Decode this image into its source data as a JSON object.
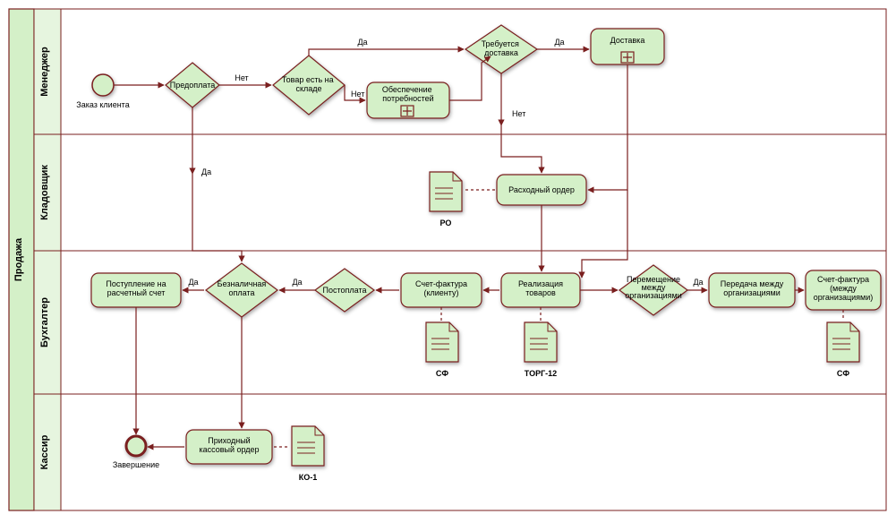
{
  "pool": {
    "title": "Продажа"
  },
  "lanes": [
    {
      "title": "Менеджер"
    },
    {
      "title": "Кладовщик"
    },
    {
      "title": "Бухгалтер"
    },
    {
      "title": "Кассир"
    }
  ],
  "events": {
    "start": {
      "label": "Заказ клиента"
    },
    "end": {
      "label": "Завершение"
    }
  },
  "gateways": {
    "prepay": "Предоплата",
    "stock": "Товар есть на складе",
    "delivery": "Требуется доставка",
    "postpay": "Постоплата",
    "cashless": "Безналичная оплата",
    "interorg": "Перемещение между организациями"
  },
  "gw_labels": {
    "yes": "Да",
    "no": "Нет"
  },
  "tasks": {
    "procure": "Обеспечение потребностей",
    "deliver": "Доставка",
    "expense_order": "Расходный ордер",
    "sale": "Реализация товаров",
    "invoice_client": "Счет-фактура (клиенту)",
    "transfer": "Передача между организациями",
    "invoice_org": "Счет-фактура (между организациями)",
    "bank_in": "Поступление на расчетный счет",
    "cash_in": "Приходный кассовый ордер"
  },
  "docs": {
    "ro": "РО",
    "torg12": "ТОРГ-12",
    "sf1": "СФ",
    "sf2": "СФ",
    "ko1": "КО-1"
  }
}
